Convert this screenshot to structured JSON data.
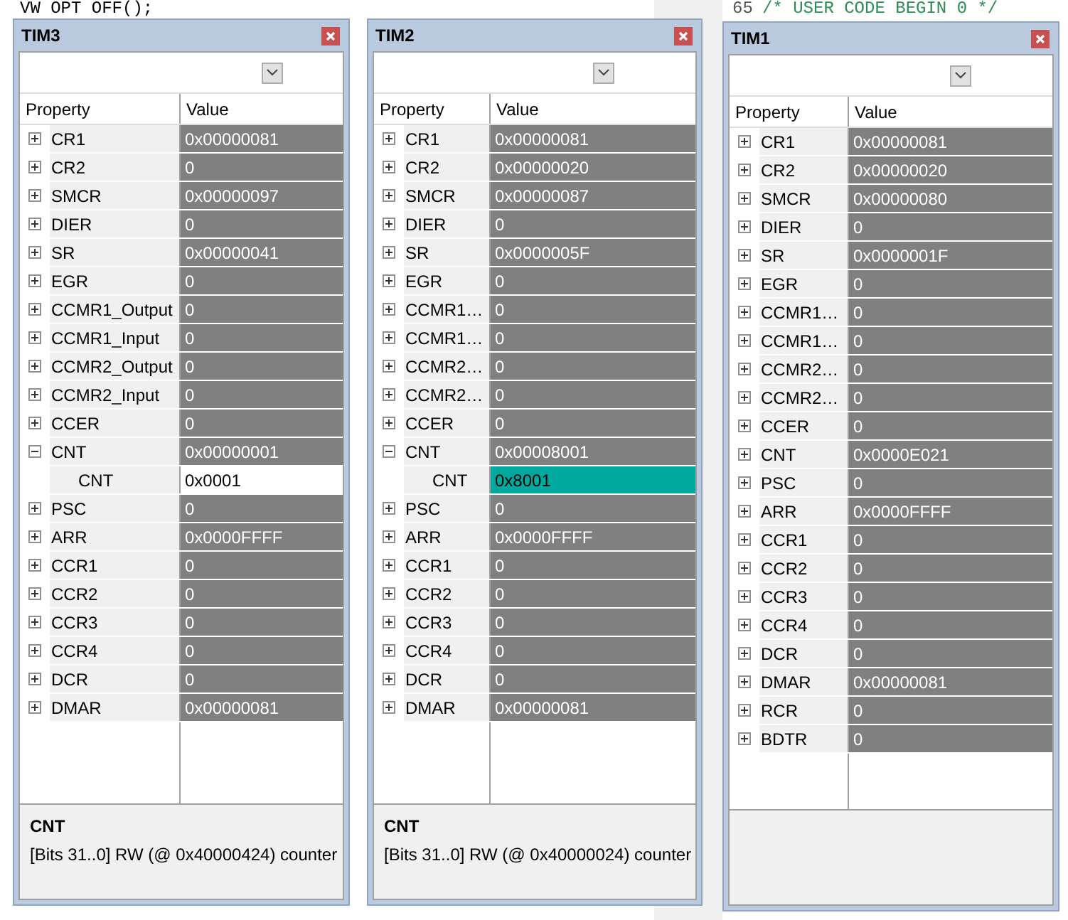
{
  "editor": {
    "code_line": "VW OPT OFF();",
    "line_number": "65",
    "comment": "/* USER CODE BEGIN 0 */"
  },
  "windows": [
    {
      "title": "TIM3",
      "columns": [
        "Property",
        "Value"
      ],
      "registers": [
        {
          "name": "CR1",
          "value": "0x00000081",
          "expanded": false
        },
        {
          "name": "CR2",
          "value": "0",
          "expanded": false
        },
        {
          "name": "SMCR",
          "value": "0x00000097",
          "expanded": false
        },
        {
          "name": "DIER",
          "value": "0",
          "expanded": false
        },
        {
          "name": "SR",
          "value": "0x00000041",
          "expanded": false
        },
        {
          "name": "EGR",
          "value": "0",
          "expanded": false
        },
        {
          "name": "CCMR1_Output",
          "value": "0",
          "expanded": false
        },
        {
          "name": "CCMR1_Input",
          "value": "0",
          "expanded": false
        },
        {
          "name": "CCMR2_Output",
          "value": "0",
          "expanded": false
        },
        {
          "name": "CCMR2_Input",
          "value": "0",
          "expanded": false
        },
        {
          "name": "CCER",
          "value": "0",
          "expanded": false
        },
        {
          "name": "CNT",
          "value": "0x00000001",
          "expanded": true,
          "children": [
            {
              "name": "CNT",
              "value": "0x0001",
              "selected": false
            }
          ]
        },
        {
          "name": "PSC",
          "value": "0",
          "expanded": false
        },
        {
          "name": "ARR",
          "value": "0x0000FFFF",
          "expanded": false
        },
        {
          "name": "CCR1",
          "value": "0",
          "expanded": false
        },
        {
          "name": "CCR2",
          "value": "0",
          "expanded": false
        },
        {
          "name": "CCR3",
          "value": "0",
          "expanded": false
        },
        {
          "name": "CCR4",
          "value": "0",
          "expanded": false
        },
        {
          "name": "DCR",
          "value": "0",
          "expanded": false
        },
        {
          "name": "DMAR",
          "value": "0x00000081",
          "expanded": false
        }
      ],
      "description": {
        "title": "CNT",
        "text": "[Bits 31..0] RW (@ 0x40000424) counter"
      }
    },
    {
      "title": "TIM2",
      "columns": [
        "Property",
        "Value"
      ],
      "registers": [
        {
          "name": "CR1",
          "value": "0x00000081",
          "expanded": false
        },
        {
          "name": "CR2",
          "value": "0x00000020",
          "expanded": false
        },
        {
          "name": "SMCR",
          "value": "0x00000087",
          "expanded": false
        },
        {
          "name": "DIER",
          "value": "0",
          "expanded": false
        },
        {
          "name": "SR",
          "value": "0x0000005F",
          "expanded": false
        },
        {
          "name": "EGR",
          "value": "0",
          "expanded": false
        },
        {
          "name": "CCMR1…",
          "value": "0",
          "expanded": false
        },
        {
          "name": "CCMR1…",
          "value": "0",
          "expanded": false
        },
        {
          "name": "CCMR2…",
          "value": "0",
          "expanded": false
        },
        {
          "name": "CCMR2…",
          "value": "0",
          "expanded": false
        },
        {
          "name": "CCER",
          "value": "0",
          "expanded": false
        },
        {
          "name": "CNT",
          "value": "0x00008001",
          "expanded": true,
          "children": [
            {
              "name": "CNT",
              "value": "0x8001",
              "selected": true
            }
          ]
        },
        {
          "name": "PSC",
          "value": "0",
          "expanded": false
        },
        {
          "name": "ARR",
          "value": "0x0000FFFF",
          "expanded": false
        },
        {
          "name": "CCR1",
          "value": "0",
          "expanded": false
        },
        {
          "name": "CCR2",
          "value": "0",
          "expanded": false
        },
        {
          "name": "CCR3",
          "value": "0",
          "expanded": false
        },
        {
          "name": "CCR4",
          "value": "0",
          "expanded": false
        },
        {
          "name": "DCR",
          "value": "0",
          "expanded": false
        },
        {
          "name": "DMAR",
          "value": "0x00000081",
          "expanded": false
        }
      ],
      "description": {
        "title": "CNT",
        "text": "[Bits 31..0] RW (@ 0x40000024) counter"
      }
    },
    {
      "title": "TIM1",
      "columns": [
        "Property",
        "Value"
      ],
      "registers": [
        {
          "name": "CR1",
          "value": "0x00000081",
          "expanded": false
        },
        {
          "name": "CR2",
          "value": "0x00000020",
          "expanded": false
        },
        {
          "name": "SMCR",
          "value": "0x00000080",
          "expanded": false
        },
        {
          "name": "DIER",
          "value": "0",
          "expanded": false
        },
        {
          "name": "SR",
          "value": "0x0000001F",
          "expanded": false
        },
        {
          "name": "EGR",
          "value": "0",
          "expanded": false
        },
        {
          "name": "CCMR1…",
          "value": "0",
          "expanded": false
        },
        {
          "name": "CCMR1…",
          "value": "0",
          "expanded": false
        },
        {
          "name": "CCMR2…",
          "value": "0",
          "expanded": false
        },
        {
          "name": "CCMR2…",
          "value": "0",
          "expanded": false
        },
        {
          "name": "CCER",
          "value": "0",
          "expanded": false
        },
        {
          "name": "CNT",
          "value": "0x0000E021",
          "expanded": false
        },
        {
          "name": "PSC",
          "value": "0",
          "expanded": false
        },
        {
          "name": "ARR",
          "value": "0x0000FFFF",
          "expanded": false
        },
        {
          "name": "CCR1",
          "value": "0",
          "expanded": false
        },
        {
          "name": "CCR2",
          "value": "0",
          "expanded": false
        },
        {
          "name": "CCR3",
          "value": "0",
          "expanded": false
        },
        {
          "name": "CCR4",
          "value": "0",
          "expanded": false
        },
        {
          "name": "DCR",
          "value": "0",
          "expanded": false
        },
        {
          "name": "DMAR",
          "value": "0x00000081",
          "expanded": false
        },
        {
          "name": "RCR",
          "value": "0",
          "expanded": false
        },
        {
          "name": "BDTR",
          "value": "0",
          "expanded": false
        }
      ]
    }
  ]
}
